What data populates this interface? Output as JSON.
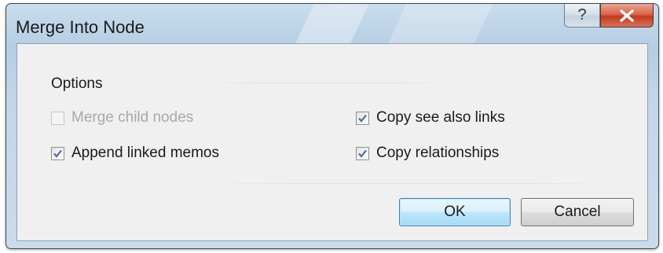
{
  "dialog": {
    "title": "Merge Into Node",
    "help_glyph": "?",
    "close_icon": "close-icon"
  },
  "options": {
    "group_label": "Options",
    "items": [
      {
        "label": "Merge child nodes",
        "checked": false,
        "enabled": false
      },
      {
        "label": "Copy see also links",
        "checked": true,
        "enabled": true
      },
      {
        "label": "Append linked memos",
        "checked": true,
        "enabled": true
      },
      {
        "label": "Copy relationships",
        "checked": true,
        "enabled": true
      }
    ]
  },
  "buttons": {
    "ok_label": "OK",
    "cancel_label": "Cancel"
  },
  "colors": {
    "accent_border": "#3c7fb1",
    "close_red": "#c23a1c",
    "disabled_text": "#a8a8a8"
  }
}
